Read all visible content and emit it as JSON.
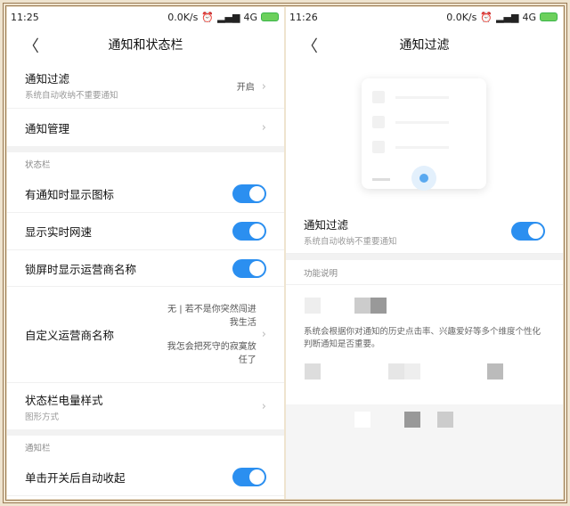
{
  "left": {
    "status": {
      "time": "11:25",
      "speed": "0.0K/s",
      "network": "4G"
    },
    "title": "通知和状态栏",
    "filter": {
      "title": "通知过滤",
      "subtitle": "系统自动收纳不重要通知",
      "value": "开启"
    },
    "manage": {
      "title": "通知管理"
    },
    "statusbar_section": "状态栏",
    "toggles": [
      {
        "label": "有通知时显示图标",
        "on": true
      },
      {
        "label": "显示实时网速",
        "on": true
      },
      {
        "label": "锁屏时显示运营商名称",
        "on": true
      }
    ],
    "carrier": {
      "title": "自定义运营商名称",
      "value1": "无 | 若不是你突然闯进我生活",
      "value2": "我怎会把死守的寂寞放任了"
    },
    "battery": {
      "title": "状态栏电量样式",
      "subtitle": "图形方式"
    },
    "notif_section": "通知栏",
    "autocollapse": {
      "label": "单击开关后自动收起",
      "on": true
    }
  },
  "right": {
    "status": {
      "time": "11:26",
      "speed": "0.0K/s",
      "network": "4G"
    },
    "title": "通知过滤",
    "filter": {
      "title": "通知过滤",
      "subtitle": "系统自动收纳不重要通知",
      "on": true
    },
    "section": "功能说明",
    "description": "系统会根据你对通知的历史点击率、兴趣爱好等多个维度个性化判断通知是否重要。"
  }
}
